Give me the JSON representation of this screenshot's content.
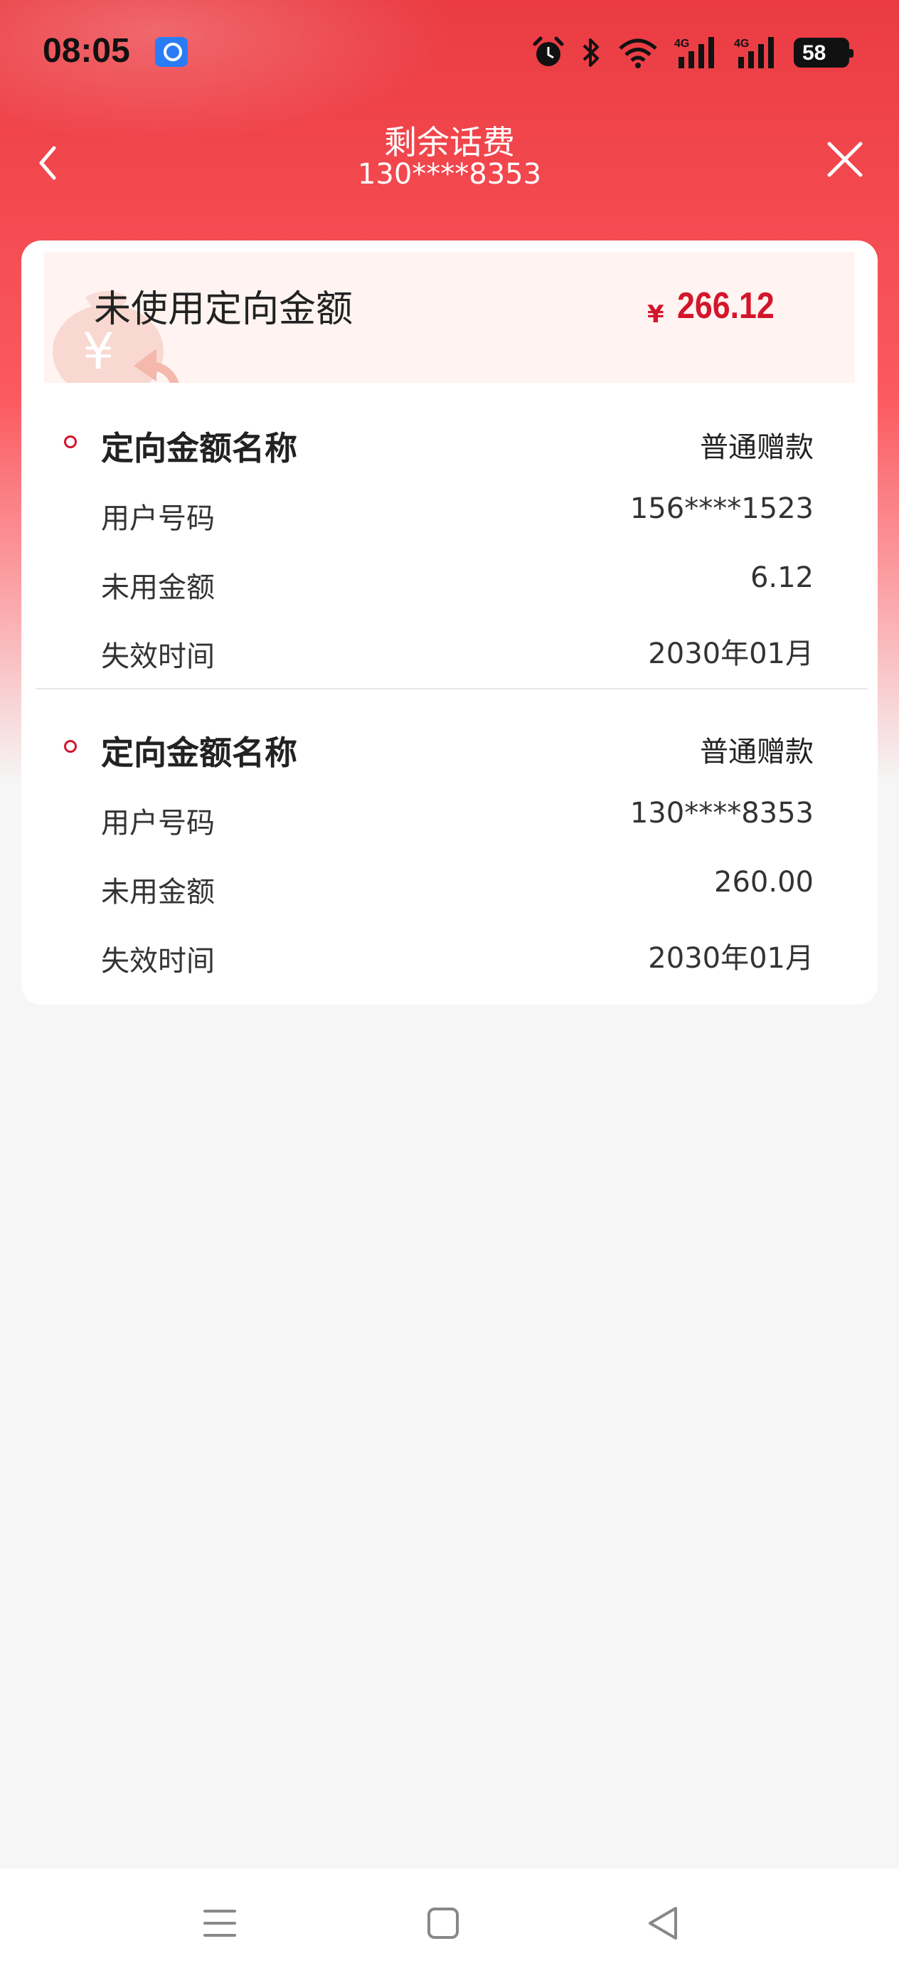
{
  "status_bar": {
    "time": "08:05",
    "battery": "58"
  },
  "header": {
    "title": "剩余话费",
    "subtitle": "130****8353"
  },
  "summary": {
    "label": "未使用定向金额",
    "currency": "¥",
    "amount": "266.12"
  },
  "groups": [
    {
      "title": "定向金额名称",
      "title_value": "普通赠款",
      "rows": [
        {
          "label": "用户号码",
          "value": "156****1523"
        },
        {
          "label": "未用金额",
          "value": "6.12"
        },
        {
          "label": "失效时间",
          "value": "2030年01月"
        }
      ]
    },
    {
      "title": "定向金额名称",
      "title_value": "普通赠款",
      "rows": [
        {
          "label": "用户号码",
          "value": "130****8353"
        },
        {
          "label": "未用金额",
          "value": "260.00"
        },
        {
          "label": "失效时间",
          "value": "2030年01月"
        }
      ]
    }
  ],
  "colors": {
    "brand_red": "#ea3b42",
    "amount_red": "#d3162c"
  },
  "icons": [
    "alarm-icon",
    "bluetooth-icon",
    "wifi-icon",
    "signal-4g-icon",
    "battery-icon",
    "back-icon",
    "close-icon",
    "menu-icon",
    "home-icon",
    "back-triangle-icon"
  ]
}
